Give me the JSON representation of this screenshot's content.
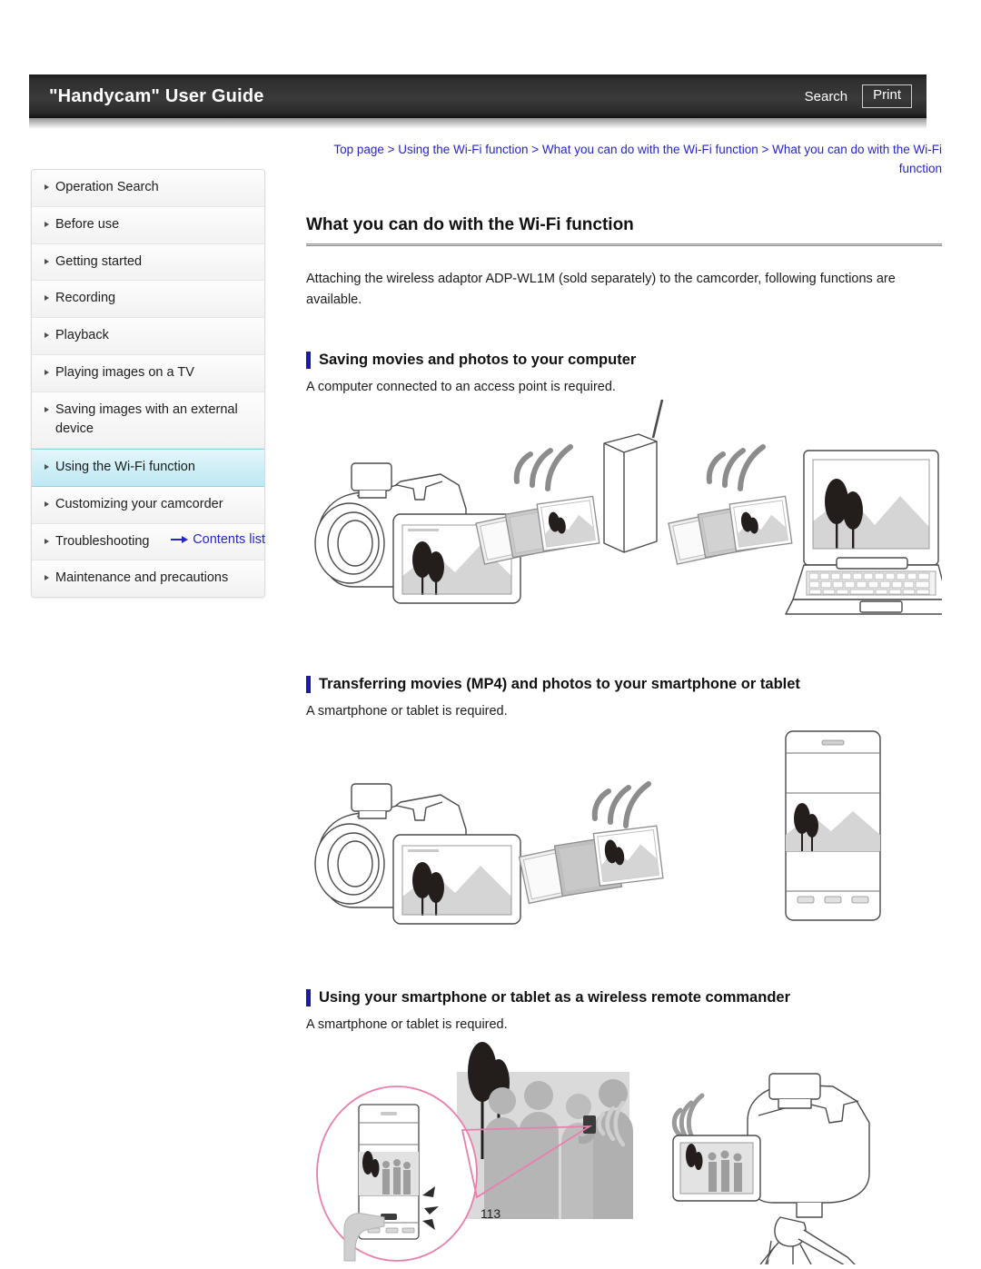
{
  "header": {
    "title": "\"Handycam\" User Guide",
    "search_label": "Search",
    "print_label": "Print"
  },
  "sidebar": {
    "items": [
      {
        "label": "Operation Search",
        "active": false
      },
      {
        "label": "Before use",
        "active": false
      },
      {
        "label": "Getting started",
        "active": false
      },
      {
        "label": "Recording",
        "active": false
      },
      {
        "label": "Playback",
        "active": false
      },
      {
        "label": "Playing images on a TV",
        "active": false
      },
      {
        "label": "Saving images with an external device",
        "active": false
      },
      {
        "label": "Using the Wi-Fi function",
        "active": true
      },
      {
        "label": "Customizing your camcorder",
        "active": false
      },
      {
        "label": "Troubleshooting",
        "active": false
      },
      {
        "label": "Maintenance and precautions",
        "active": false
      }
    ],
    "contents_link": "Contents list"
  },
  "main": {
    "breadcrumb": "Top page > Using the Wi-Fi function > What you can do with the Wi-Fi function > What you can do with the Wi-Fi function",
    "page_title": "What you can do with the Wi-Fi function",
    "intro": "Attaching the wireless adaptor ADP-WL1M (sold separately) to the camcorder, following functions are available.",
    "sections": [
      {
        "title": "Saving movies and photos to your computer",
        "note": "A computer connected to an access point is required."
      },
      {
        "title": "Transferring movies (MP4) and photos to your smartphone or tablet",
        "note": "A smartphone or tablet is required."
      },
      {
        "title": "Using your smartphone or tablet as a wireless remote commander",
        "note": "A smartphone or tablet is required."
      }
    ]
  },
  "footer": {
    "page_number": "113"
  },
  "colors": {
    "link": "#2626c8",
    "accent_bar": "#1a1aa8",
    "active_nav": "#cdeef6",
    "header_bg": "#2e2e2e"
  }
}
